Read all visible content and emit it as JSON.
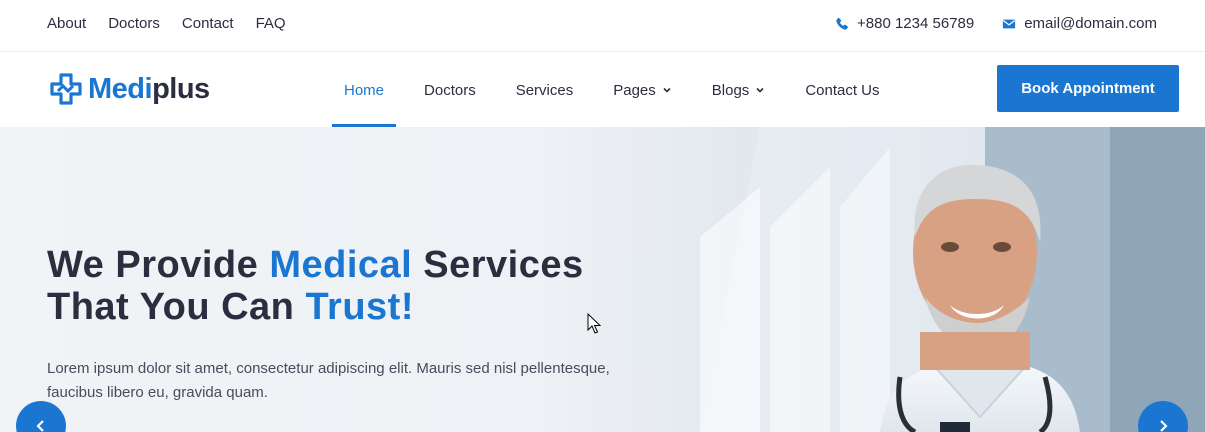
{
  "topbar": {
    "links": [
      "About",
      "Doctors",
      "Contact",
      "FAQ"
    ],
    "phone": "+880 1234 56789",
    "email": "email@domain.com"
  },
  "header": {
    "logo_part1": "Medi",
    "logo_part2": "plus",
    "nav": [
      "Home",
      "Doctors",
      "Services",
      "Pages",
      "Blogs",
      "Contact Us"
    ],
    "active_nav": "Home",
    "book_button": "Book Appointment"
  },
  "hero": {
    "title_1": "We Provide ",
    "title_2": "Medical",
    "title_3": " Services",
    "title_4": "That You Can ",
    "title_5": "Trust!",
    "description": "Lorem ipsum dolor sit amet, consectetur adipiscing elit. Mauris sed nisl pellentesque, faucibus libero eu, gravida quam."
  },
  "colors": {
    "accent": "#1a76d1",
    "text": "#2c2d3f"
  },
  "icons": [
    "phone-icon",
    "envelope-icon",
    "logo-cross-icon",
    "chevron-down-icon",
    "chevron-left-icon",
    "chevron-right-icon",
    "mouse-cursor-icon"
  ]
}
